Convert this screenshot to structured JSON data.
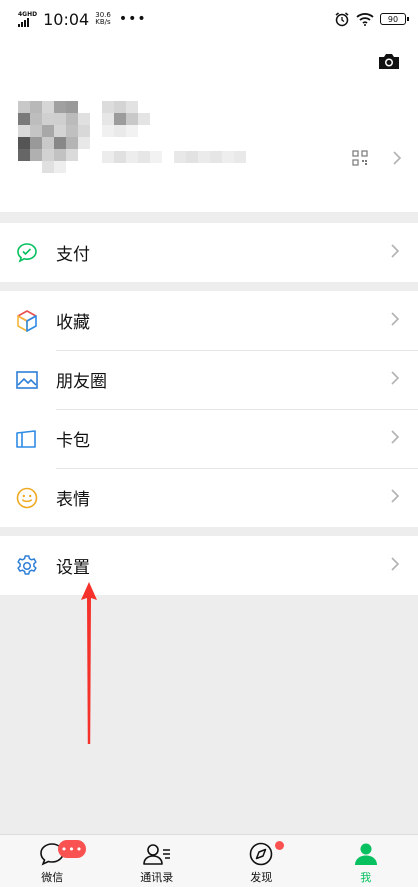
{
  "status_bar": {
    "network": "4G",
    "network_sup": "HD",
    "time": "10:04",
    "speed_value": "30.6",
    "speed_unit": "KB/s",
    "more": "•••",
    "battery": "90"
  },
  "profile": {
    "nickname": "",
    "wechat_id": ""
  },
  "menu": {
    "pay": "支付",
    "favorites": "收藏",
    "moments": "朋友圈",
    "cards": "卡包",
    "stickers": "表情",
    "settings": "设置"
  },
  "tabbar": {
    "chats": "微信",
    "chats_badge": "•••",
    "contacts": "通讯录",
    "discover": "发现",
    "me": "我",
    "active_tab": "我"
  },
  "colors": {
    "accent": "#07c160",
    "badge": "#fa5151",
    "annotation_arrow": "#f5312b"
  }
}
